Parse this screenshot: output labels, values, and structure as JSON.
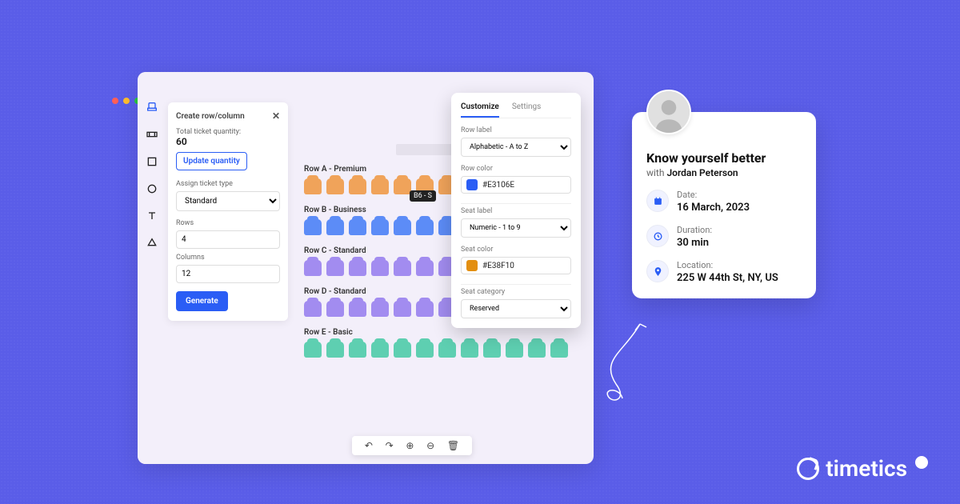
{
  "window": {
    "dot_colors": [
      "#ff5f56",
      "#ffbd2e",
      "#27c93f"
    ]
  },
  "leftpanel": {
    "title": "Create row/column",
    "quantity_label": "Total ticket quantity:",
    "quantity": "60",
    "update_btn": "Update quantity",
    "assign_label": "Assign ticket type",
    "assign_value": "Standard",
    "rows_label": "Rows",
    "rows_value": "4",
    "cols_label": "Columns",
    "cols_value": "12",
    "generate_btn": "Generate"
  },
  "seatmap": {
    "rows": [
      {
        "label": "Row A - Premium",
        "color": "#f0a35a",
        "count": 8
      },
      {
        "label": "Row B - Business",
        "color": "#5c8cf7",
        "count": 10
      },
      {
        "label": "Row C - Standard",
        "color": "#a28cf0",
        "count": 10
      },
      {
        "label": "Row D - Standard",
        "color": "#a28cf0",
        "count": 10
      },
      {
        "label": "Row E - Basic",
        "color": "#5ecfb1",
        "count": 12
      }
    ],
    "tooltip": "B6 - S"
  },
  "customize": {
    "tab1": "Customize",
    "tab2": "Settings",
    "row_label_label": "Row label",
    "row_label_value": "Alphabetic - A to Z",
    "row_color_label": "Row color",
    "row_color_hex": "#E3106E",
    "row_color_swatch": "#2a5df5",
    "seat_label_label": "Seat label",
    "seat_label_value": "Numeric - 1 to 9",
    "seat_color_label": "Seat color",
    "seat_color_hex": "#E38F10",
    "seat_color_swatch": "#e38f10",
    "category_label": "Seat category",
    "category_value": "Reserved"
  },
  "card": {
    "title": "Know yourself better",
    "with": "with",
    "host": "Jordan Peterson",
    "date_label": "Date:",
    "date_value": "16 March, 2023",
    "duration_label": "Duration:",
    "duration_value": "30 min",
    "location_label": "Location:",
    "location_value": "225 W 44th St, NY, US"
  },
  "brand": {
    "name": "timetics"
  }
}
